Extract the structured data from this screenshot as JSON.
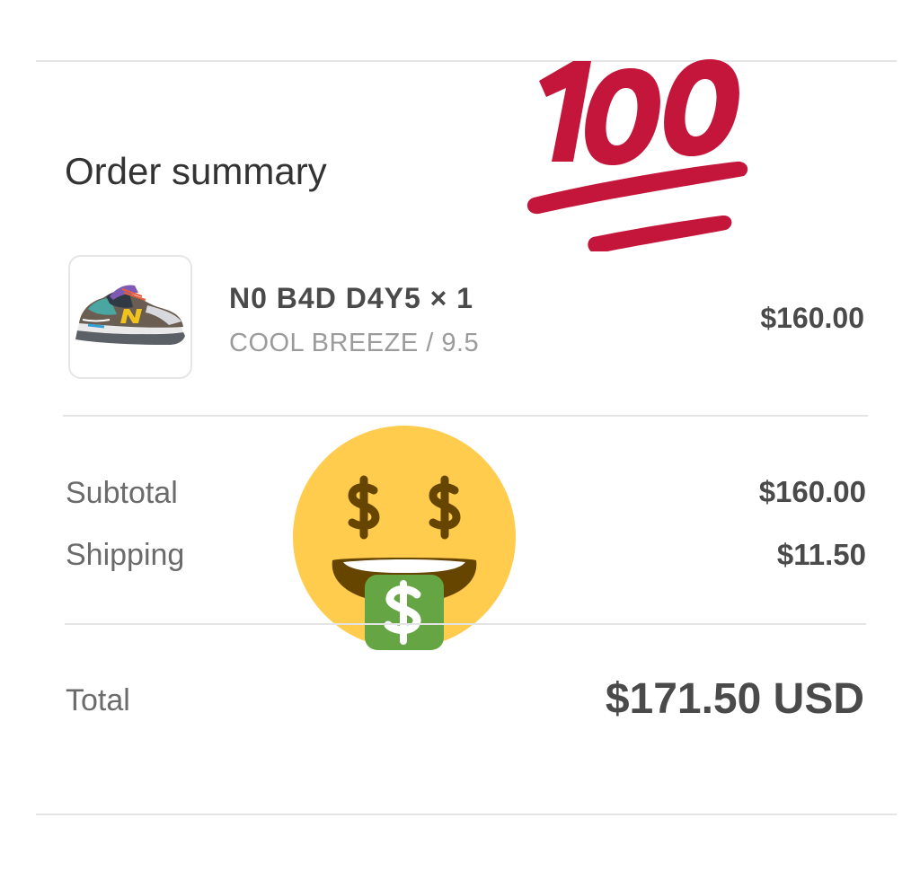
{
  "order": {
    "heading": "Order summary",
    "item": {
      "name": "N0 B4D D4Y5 × 1",
      "variant": "COOL BREEZE / 9.5",
      "price": "$160.00",
      "image_icon": "sneaker-thumbnail"
    },
    "subtotal": {
      "label": "Subtotal",
      "value": "$160.00"
    },
    "shipping": {
      "label": "Shipping",
      "value": "$11.50"
    },
    "total": {
      "label": "Total",
      "value": "$171.50 USD"
    }
  },
  "stickers": {
    "hundred": {
      "icon": "hundred-points-emoji",
      "text": "100",
      "color": "#c4163a"
    },
    "money_face": {
      "icon": "money-mouth-face-emoji",
      "symbol": "$",
      "face_color": "#ffcc4d",
      "tongue_color": "#65a543"
    }
  },
  "colors": {
    "text_primary": "#333333",
    "text_muted": "#9b9b9b",
    "divider": "#e4e4e4"
  }
}
